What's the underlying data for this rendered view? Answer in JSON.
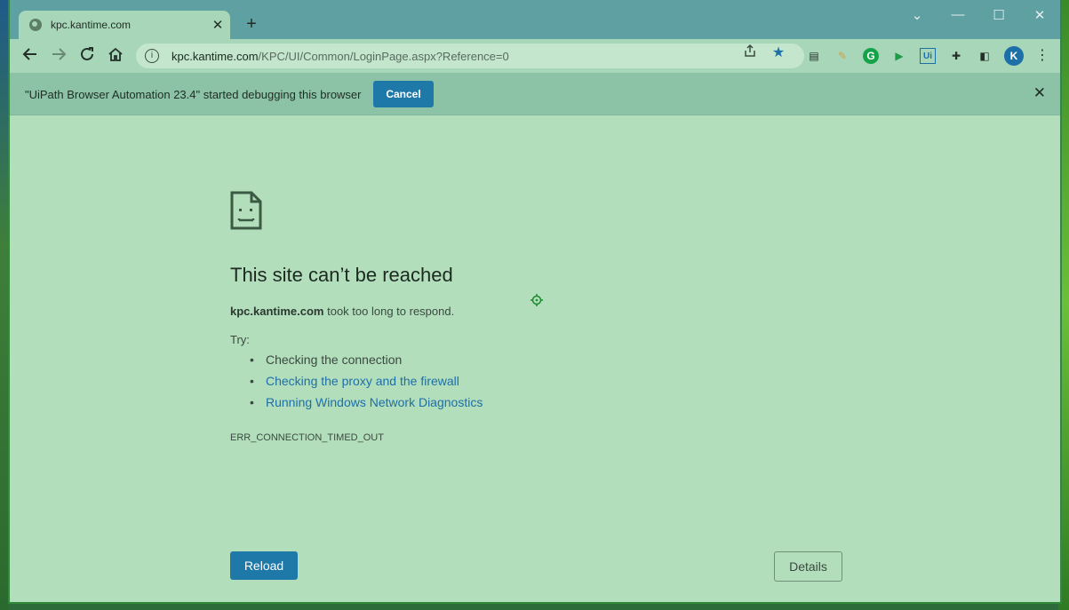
{
  "browser": {
    "tab_title": "kpc.kantime.com",
    "tab_close": "✕",
    "new_tab": "+",
    "url_host": "kpc.kantime.com",
    "url_path": "/KPC/UI/Common/LoginPage.aspx?Reference=0"
  },
  "infobar": {
    "message": "\"UiPath Browser Automation 23.4\" started debugging this browser",
    "cancel_label": "Cancel",
    "close": "✕"
  },
  "error_page": {
    "headline": "This site can’t be reached",
    "host": "kpc.kantime.com",
    "reason": " took too long to respond.",
    "try_label": "Try:",
    "suggestions": [
      {
        "text": "Checking the connection",
        "link": false
      },
      {
        "text": "Checking the proxy and the firewall",
        "link": true
      },
      {
        "text": "Running Windows Network Diagnostics",
        "link": true
      }
    ],
    "error_code": "ERR_CONNECTION_TIMED_OUT",
    "reload_label": "Reload",
    "details_label": "Details"
  },
  "icons": {
    "back": "back-arrow-icon",
    "forward": "forward-arrow-icon",
    "reload": "reload-icon",
    "home": "home-icon",
    "info": "info-icon",
    "share": "share-icon",
    "star": "star-icon",
    "menu": "kebab-menu-icon"
  },
  "colors": {
    "accent": "#1e78a8",
    "link": "#1d6fa8",
    "page_bg": "#b3debc",
    "titlebar": "#5fa0a3"
  },
  "profile_initial": "K"
}
